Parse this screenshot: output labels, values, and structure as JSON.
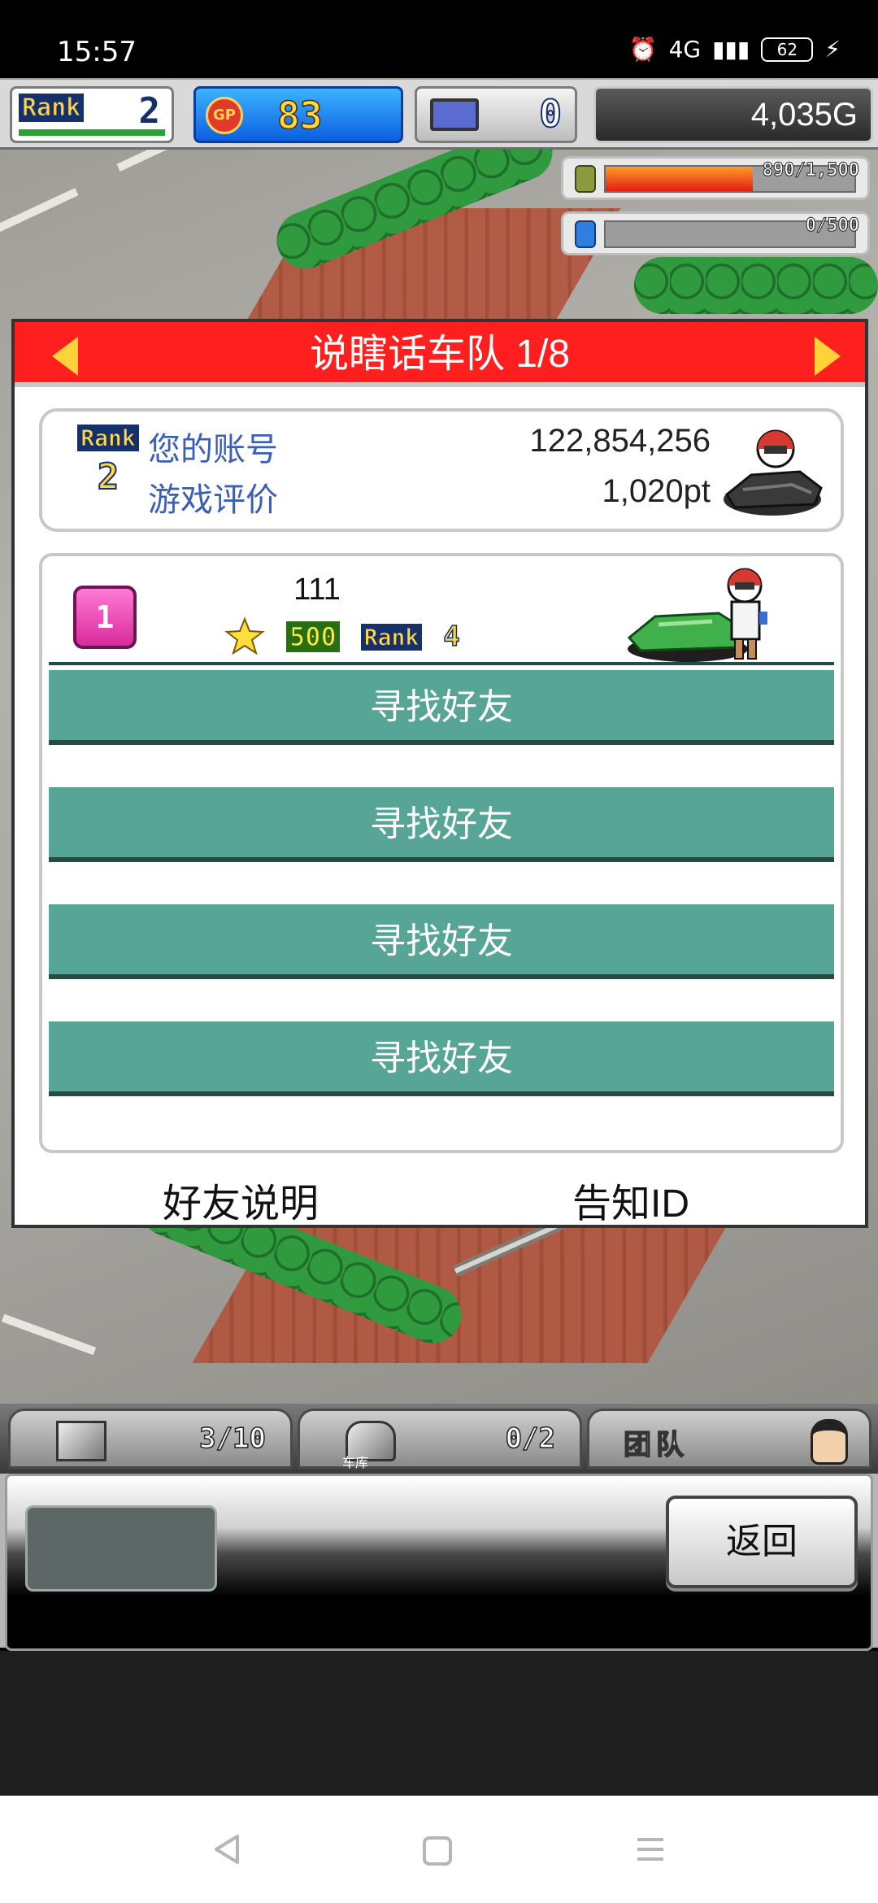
{
  "status_bar": {
    "time": "15:57",
    "network": "4G",
    "battery": "62"
  },
  "hud": {
    "rank_label": "Rank",
    "rank_value": "2",
    "gp_label": "GP",
    "gp_value": "83",
    "pc_value": "0",
    "money": "4,035G",
    "fuel_text": "890/1,500",
    "fuel_fraction": 0.593,
    "water_text": "0/500",
    "water_fraction": 0
  },
  "dialog": {
    "team_name": "说瞎话车队 1/8",
    "account": {
      "rank_label": "Rank",
      "rank_value": "2",
      "account_label": "您的账号",
      "account_value": "122,854,256",
      "rating_label": "游戏评价",
      "rating_value": "1,020pt"
    },
    "member": {
      "slot": "1",
      "name": "111",
      "points": "500",
      "rank_label": "Rank",
      "rank_value": "4"
    },
    "find_friend_buttons": [
      "寻找好友",
      "寻找好友",
      "寻找好友",
      "寻找好友"
    ],
    "footer": {
      "friend_info": "好友说明",
      "tell_id": "告知ID"
    }
  },
  "bottom_hud": {
    "storage_count": "3/10",
    "garage_label": "车库",
    "garage_count": "0/2",
    "team_label": "团队",
    "back_button": "返回"
  },
  "icons": {
    "prev": "triangle-left-icon",
    "next": "triangle-right-icon",
    "star": "star-icon",
    "nav_back": "nav-back-icon",
    "nav_home": "nav-home-icon",
    "nav_menu": "nav-menu-icon"
  },
  "colors": {
    "header_red": "#ff1f1f",
    "find_button_teal": "#56a596",
    "label_blue": "#3a5fb5"
  }
}
